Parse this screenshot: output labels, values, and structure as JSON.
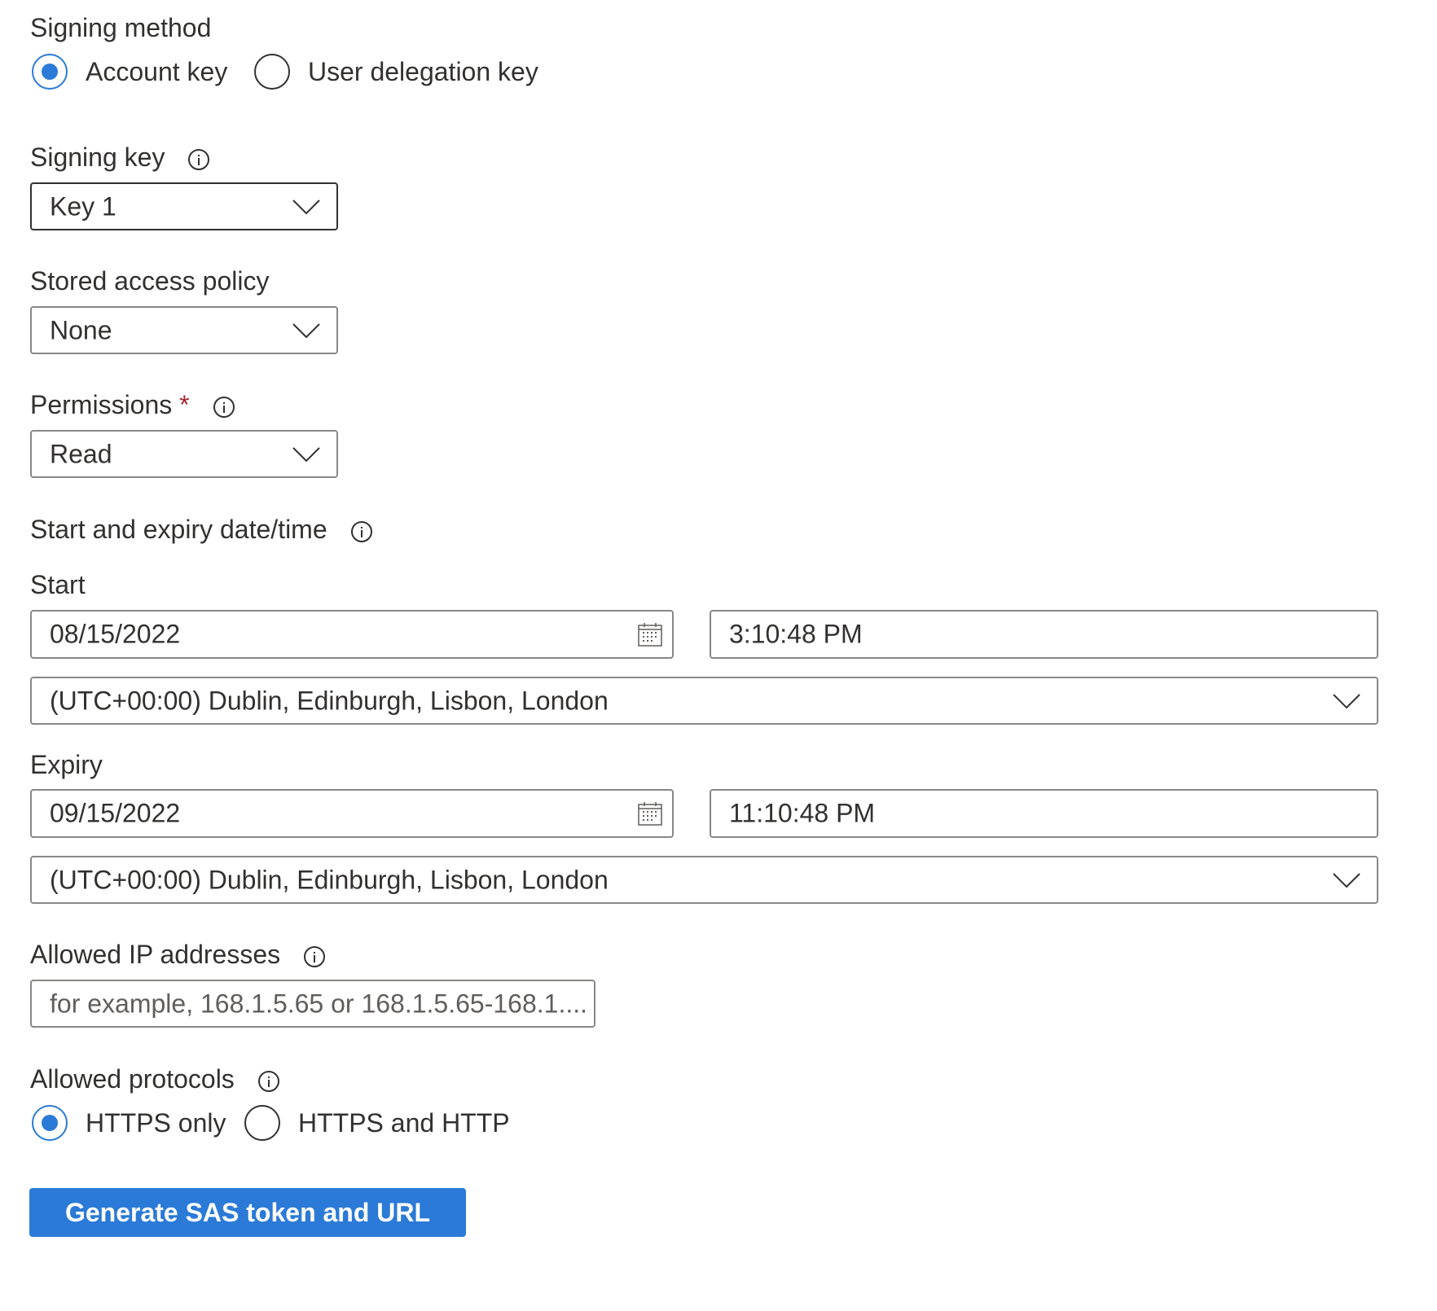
{
  "signing_method": {
    "label": "Signing method",
    "options": [
      {
        "label": "Account key",
        "selected": true
      },
      {
        "label": "User delegation key",
        "selected": false
      }
    ]
  },
  "signing_key": {
    "label": "Signing key",
    "info_icon": "info-icon",
    "value": "Key 1"
  },
  "stored_access_policy": {
    "label": "Stored access policy",
    "value": "None"
  },
  "permissions": {
    "label": "Permissions",
    "required_marker": "*",
    "info_icon": "info-icon",
    "value": "Read"
  },
  "start_expiry": {
    "label": "Start and expiry date/time",
    "info_icon": "info-icon",
    "start": {
      "label": "Start",
      "date": "08/15/2022",
      "time": "3:10:48 PM",
      "timezone": "(UTC+00:00) Dublin, Edinburgh, Lisbon, London"
    },
    "expiry": {
      "label": "Expiry",
      "date": "09/15/2022",
      "time": "11:10:48 PM",
      "timezone": "(UTC+00:00) Dublin, Edinburgh, Lisbon, London"
    }
  },
  "allowed_ip": {
    "label": "Allowed IP addresses",
    "info_icon": "info-icon",
    "value": "",
    "placeholder": "for example, 168.1.5.65 or 168.1.5.65-168.1...."
  },
  "allowed_protocols": {
    "label": "Allowed protocols",
    "info_icon": "info-icon",
    "options": [
      {
        "label": "HTTPS only",
        "selected": true
      },
      {
        "label": "HTTPS and HTTP",
        "selected": false
      }
    ]
  },
  "generate_button": {
    "label": "Generate SAS token and URL"
  },
  "colors": {
    "accent": "#2b7ad7",
    "required": "#a4262c",
    "text": "#323130",
    "border": "#8a8886"
  }
}
